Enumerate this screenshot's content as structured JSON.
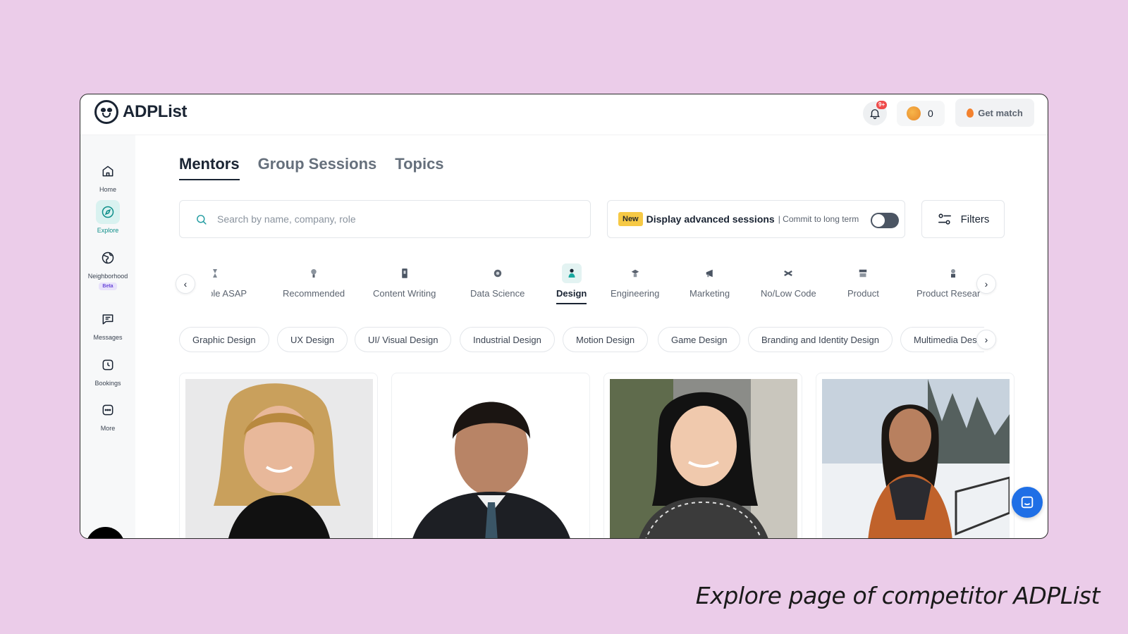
{
  "app": {
    "name": "ADPList"
  },
  "topbar": {
    "notifications_badge": "9+",
    "coins_count": "0",
    "get_match_label": "Get match"
  },
  "sidebar": {
    "items": [
      {
        "label": "Home",
        "icon": "home-icon",
        "active": false
      },
      {
        "label": "Explore",
        "icon": "compass-icon",
        "active": true
      },
      {
        "label": "Neighborhood",
        "icon": "globe-icon",
        "active": false,
        "badge": "Beta"
      },
      {
        "label": "Messages",
        "icon": "message-icon",
        "active": false
      },
      {
        "label": "Bookings",
        "icon": "clock-icon",
        "active": false
      },
      {
        "label": "More",
        "icon": "more-icon",
        "active": false
      }
    ]
  },
  "tabs": [
    {
      "label": "Mentors",
      "active": true
    },
    {
      "label": "Group Sessions",
      "active": false
    },
    {
      "label": "Topics",
      "active": false
    }
  ],
  "search": {
    "placeholder": "Search by name, company, role"
  },
  "advanced": {
    "badge": "New",
    "title": "Display advanced sessions",
    "subtitle": "| Commit to long term",
    "toggle_on": false
  },
  "filters_label": "Filters",
  "categories": [
    {
      "label": "Available ASAP",
      "active": false
    },
    {
      "label": "Recommended",
      "active": false
    },
    {
      "label": "Content Writing",
      "active": false
    },
    {
      "label": "Data Science",
      "active": false
    },
    {
      "label": "Design",
      "active": true
    },
    {
      "label": "Engineering",
      "active": false
    },
    {
      "label": "Marketing",
      "active": false
    },
    {
      "label": "No/Low Code",
      "active": false
    },
    {
      "label": "Product",
      "active": false
    },
    {
      "label": "Product Research",
      "active": false
    }
  ],
  "chips": [
    "Graphic Design",
    "UX Design",
    "UI/ Visual Design",
    "Industrial Design",
    "Motion Design",
    "Game Design",
    "Branding and Identity Design",
    "Multimedia Design"
  ],
  "caption": "Explore page of competitor ADPList",
  "colors": {
    "background": "#ebcce9",
    "accent": "#0f8f8a",
    "chat": "#1f6fe6",
    "badge": "#f6c945"
  }
}
